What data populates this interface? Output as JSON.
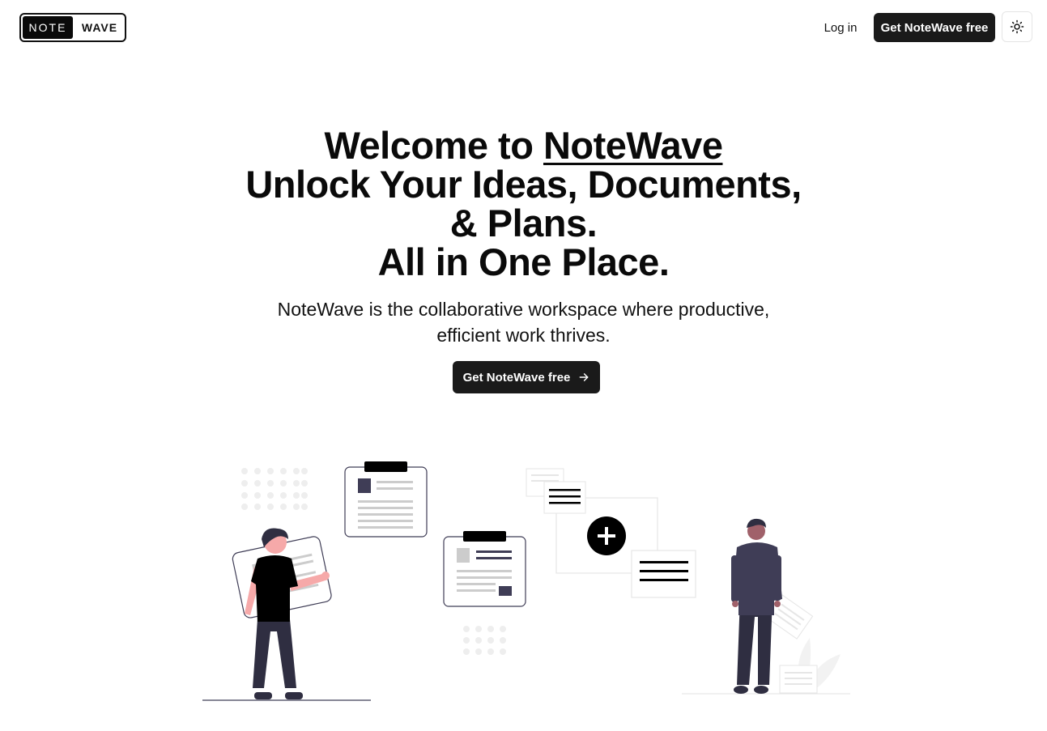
{
  "nav": {
    "logo_left": "NOTE",
    "logo_right": "WAVE",
    "login_label": "Log in",
    "cta_label": "Get NoteWave free",
    "theme_icon": "sun-icon"
  },
  "hero": {
    "title_prefix": "Welcome to ",
    "title_brand": "NoteWave",
    "title_line2": "Unlock Your Ideas, Documents,",
    "title_line3": "& Plans.",
    "title_line4": "All in One Place.",
    "subtitle_line1": "NoteWave is the collaborative workspace where productive,",
    "subtitle_line2": "efficient work thrives.",
    "cta_label": "Get NoteWave free",
    "cta_icon": "arrow-right-icon"
  },
  "colors": {
    "primary": "#1a1a1a",
    "text": "#0a0a0a",
    "accent_skin": "#f6a9a9",
    "figure_dark": "#2f2e41",
    "figure_purple": "#3f3d56"
  }
}
